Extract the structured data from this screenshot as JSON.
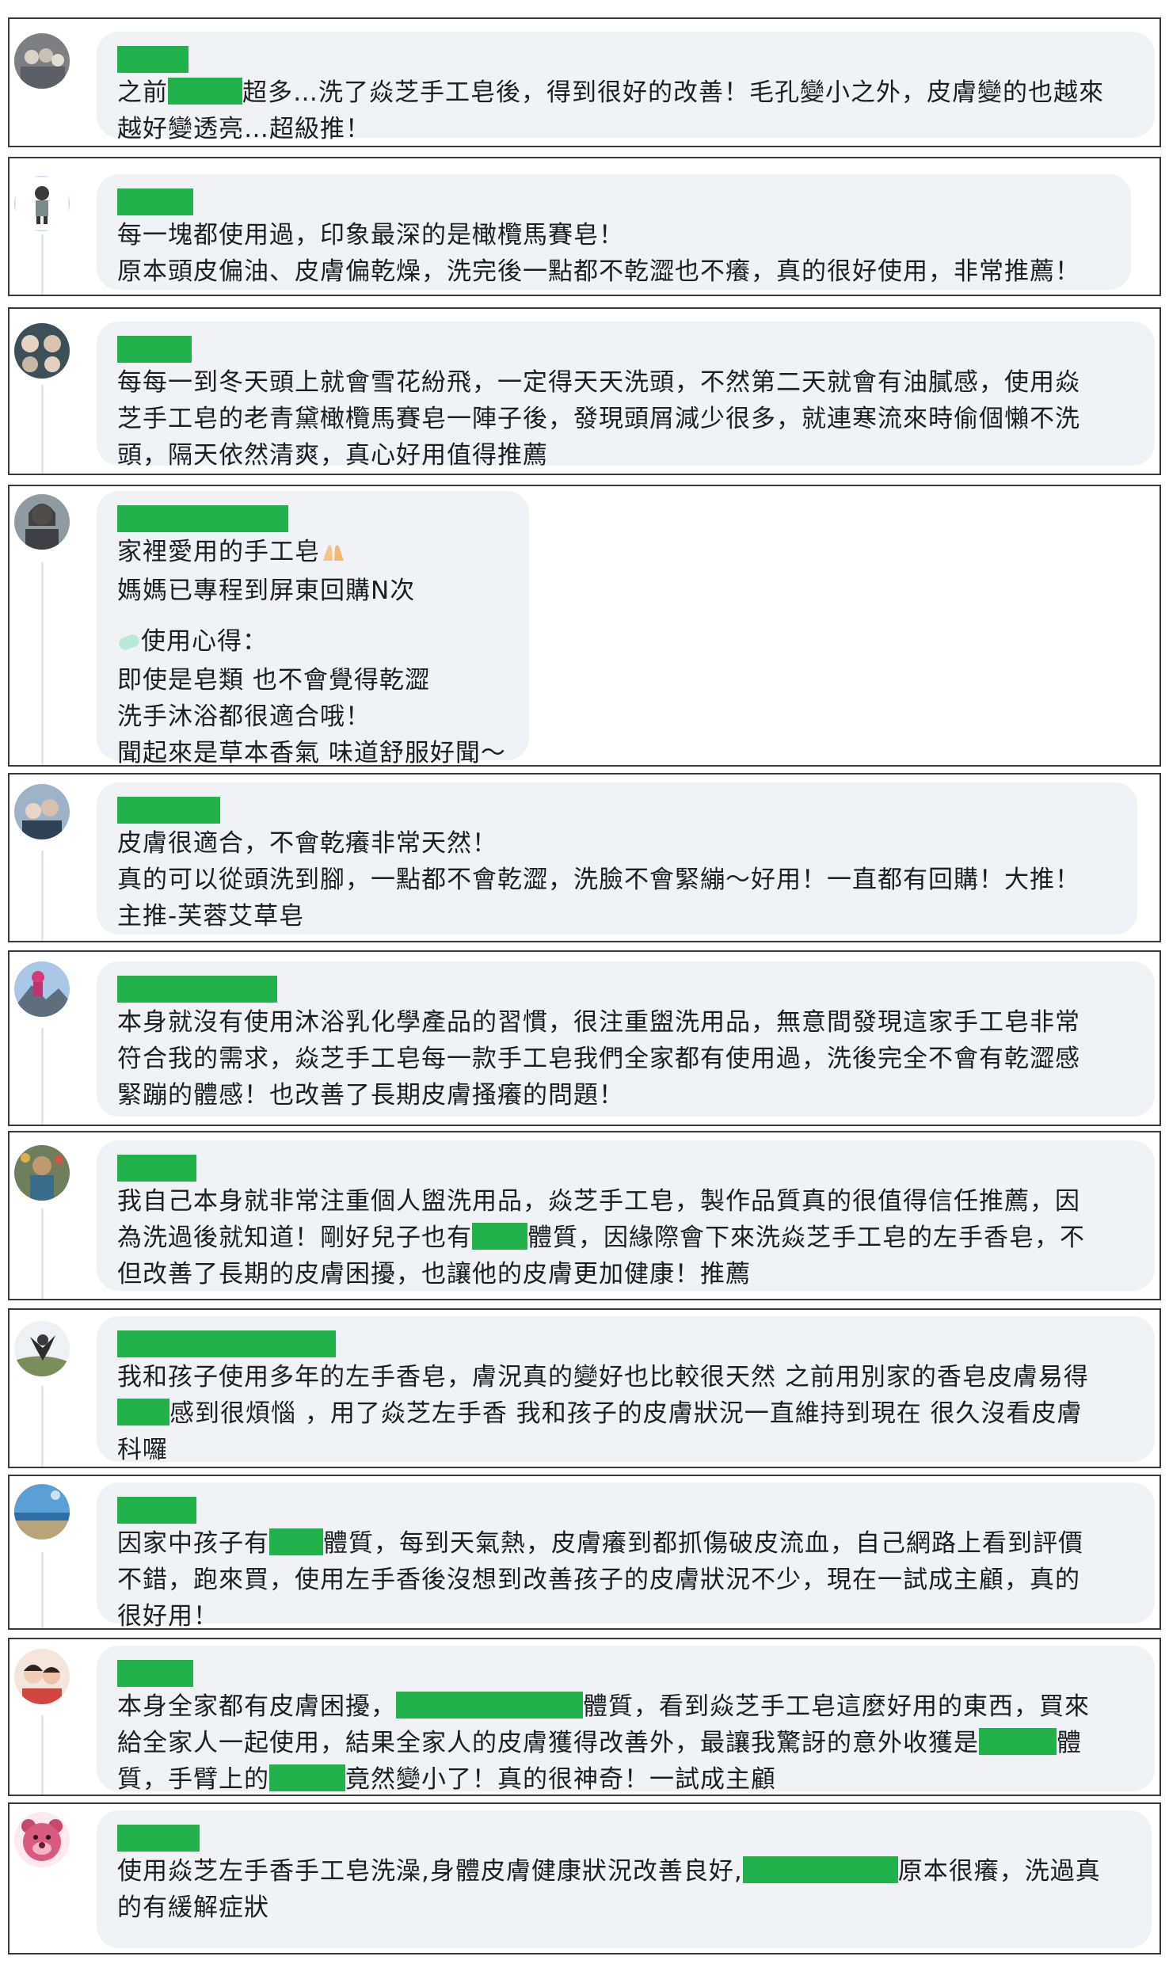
{
  "colors": {
    "redaction": "#22b24c",
    "bubble": "#f0f2f5",
    "border": "#3a3a3a"
  },
  "comments": [
    {
      "avatar": "group-photo-avatar",
      "l1a": "之前",
      "l1b": "超多…洗了焱芝手工皂後，得到很好的改善！毛孔變小之外，皮膚變的也越來",
      "l2": "越好變透亮…超級推！"
    },
    {
      "avatar": "cartoon-person-avatar",
      "l1": "每一塊都使用過，印象最深的是橄欖馬賽皂！",
      "l2": "原本頭皮偏油、皮膚偏乾燥，洗完後一點都不乾澀也不癢，真的很好使用，非常推薦！"
    },
    {
      "avatar": "selfie-collage-avatar",
      "l1": "每每一到冬天頭上就會雪花紛飛，一定得天天洗頭，不然第二天就會有油膩感，使用焱",
      "l2": "芝手工皂的老青黛橄欖馬賽皂一陣子後，發現頭屑減少很多，就連寒流來時偷個懶不洗",
      "l3": "頭，隔天依然清爽，真心好用值得推薦"
    },
    {
      "avatar": "woman-portrait-avatar",
      "l1": "家裡愛用的手工皂",
      "l2": "媽媽已專程到屏東回購N次",
      "l3": "使用心得：",
      "l4": "即使是皂類 也不會覺得乾澀",
      "l5": "洗手沐浴都很適合哦！",
      "l6": "聞起來是草本香氣 味道舒服好聞～"
    },
    {
      "avatar": "family-photo-avatar",
      "l1": "皮膚很適合，不會乾癢非常天然！",
      "l2": "真的可以從頭洗到腳，一點都不會乾澀，洗臉不會緊繃～好用！一直都有回購！大推！",
      "l3": "主推-芙蓉艾草皂"
    },
    {
      "avatar": "mountain-photo-avatar",
      "l1": "本身就沒有使用沐浴乳化學產品的習慣，很注重盥洗用品，無意間發現這家手工皂非常",
      "l2": "符合我的需求，焱芝手工皂每一款手工皂我們全家都有使用過，洗後完全不會有乾澀感",
      "l3": "緊蹦的體感！也改善了長期皮膚搔癢的問題！"
    },
    {
      "avatar": "festival-photo-avatar",
      "l1": "我自己本身就非常注重個人盥洗用品，焱芝手工皂，製作品質真的很值得信任推薦，因",
      "l2a": "為洗過後就知道！剛好兒子也有",
      "l2b": "體質，因緣際會下來洗焱芝手工皂的左手香皂，不",
      "l3": "但改善了長期的皮膚困擾，也讓他的皮膚更加健康！推薦"
    },
    {
      "avatar": "outdoor-photo-avatar",
      "l1": "我和孩子使用多年的左手香皂，膚況真的變好也比較很天然 之前用別家的香皂皮膚易得",
      "l2b": "感到很煩惱 ，用了焱芝左手香 我和孩子的皮膚狀況一直維持到現在 很久沒看皮膚",
      "l3": "科囉"
    },
    {
      "avatar": "beach-photo-avatar",
      "l1a": "因家中孩子有",
      "l1b": "體質，每到天氣熱，皮膚癢到都抓傷破皮流血，自己網路上看到評價",
      "l2": "不錯，跑來買，使用左手香後沒想到改善孩子的皮膚狀況不少，現在一試成主顧，真的",
      "l3": "很好用！"
    },
    {
      "avatar": "kids-photo-avatar",
      "l1a": "本身全家都有皮膚困擾，",
      "l1b": "體質，看到焱芝手工皂這麼好用的東西，買來",
      "l2a": "給全家人一起使用，結果全家人的皮膚獲得改善外，最讓我驚訝的意外收獲是",
      "l2b": "體",
      "l3a": "質，手臂上的",
      "l3b": "竟然變小了！真的很神奇！一試成主顧"
    },
    {
      "avatar": "pink-bear-avatar",
      "l1a": "使用焱芝左手香手工皂洗澡,身體皮膚健康狀況改善良好,",
      "l1b": "原本很癢，洗過真",
      "l2": "的有緩解症狀"
    }
  ]
}
